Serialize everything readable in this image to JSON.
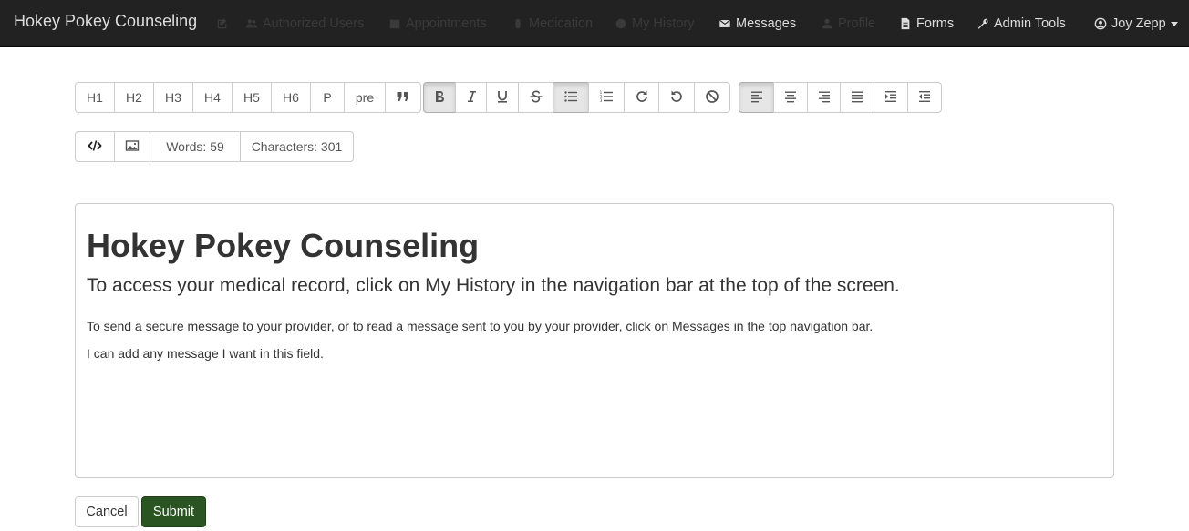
{
  "navbar": {
    "brand": "Hokey Pokey Counseling",
    "items": [
      {
        "label": "Authorized Users",
        "icon": "users-icon"
      },
      {
        "label": "Appointments",
        "icon": "calendar-icon"
      },
      {
        "label": "Medication",
        "icon": "pill-icon"
      },
      {
        "label": "My History",
        "icon": "history-icon"
      },
      {
        "label": "Messages",
        "icon": "envelope-icon"
      },
      {
        "label": "Profile",
        "icon": "user-icon"
      },
      {
        "label": "Forms",
        "icon": "file-icon"
      },
      {
        "label": "Admin Tools",
        "icon": "wrench-icon"
      },
      {
        "label": "Joy Zepp",
        "icon": "user-circle-icon"
      }
    ]
  },
  "toolbar": {
    "headings": [
      "H1",
      "H2",
      "H3",
      "H4",
      "H5",
      "H6",
      "P",
      "pre"
    ],
    "words": "Words: 59",
    "characters": "Characters: 301"
  },
  "editor": {
    "heading": "Hokey Pokey Counseling",
    "lead": "To access your medical record, click on My History in the navigation bar at the top of the screen.",
    "paragraph1": "To send a secure message to your provider, or to read a message sent to you by your provider, click on Messages in the top navigation bar.",
    "paragraph2": "I can add any message I want in this field."
  },
  "actions": {
    "cancel": "Cancel",
    "submit": "Submit"
  },
  "colors": {
    "navbar_bg": "#222222",
    "submit_bg": "#2a5422"
  }
}
